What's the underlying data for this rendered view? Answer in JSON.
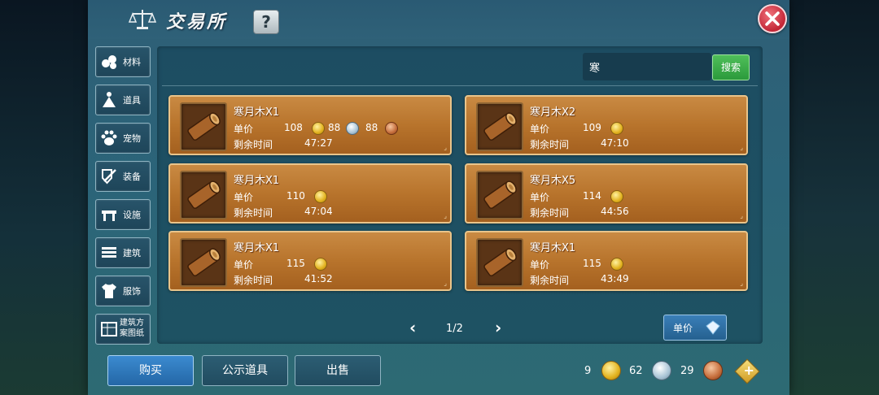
{
  "window": {
    "title": "交易所",
    "help_label": "?"
  },
  "sidebar": {
    "items": [
      {
        "label": "材料",
        "icon": "materials-icon"
      },
      {
        "label": "道具",
        "icon": "item-icon"
      },
      {
        "label": "宠物",
        "icon": "pet-paw-icon"
      },
      {
        "label": "装备",
        "icon": "equipment-icon"
      },
      {
        "label": "设施",
        "icon": "facility-icon"
      },
      {
        "label": "建筑",
        "icon": "building-icon"
      },
      {
        "label": "服饰",
        "icon": "clothing-icon"
      },
      {
        "label": "建筑方案图纸",
        "icon": "blueprint-icon"
      }
    ]
  },
  "search": {
    "value": "寒",
    "button_label": "搜索"
  },
  "listings": {
    "price_label": "单价",
    "time_label": "剩余时间",
    "items": [
      {
        "name": "寒月木X1",
        "gold": "108",
        "silver": "88",
        "copper": "88",
        "time": "47:27"
      },
      {
        "name": "寒月木X2",
        "gold": "109",
        "time": "47:10"
      },
      {
        "name": "寒月木X1",
        "gold": "110",
        "time": "47:04"
      },
      {
        "name": "寒月木X5",
        "gold": "114",
        "time": "44:56"
      },
      {
        "name": "寒月木X1",
        "gold": "115",
        "time": "41:52"
      },
      {
        "name": "寒月木X1",
        "gold": "115",
        "time": "43:49"
      }
    ]
  },
  "pager": {
    "text": "1/2",
    "prev": "‹",
    "next": "›"
  },
  "sort": {
    "label": "单价"
  },
  "actions": {
    "buy": "购买",
    "public_items": "公示道具",
    "sell": "出售"
  },
  "currency": {
    "gold": "9",
    "silver": "62",
    "copper": "29",
    "add": "+"
  },
  "colors": {
    "accent_green": "#2b9a3c",
    "accent_blue": "#2467a6",
    "card_orange": "#b8742c",
    "close_red": "#c22636"
  }
}
